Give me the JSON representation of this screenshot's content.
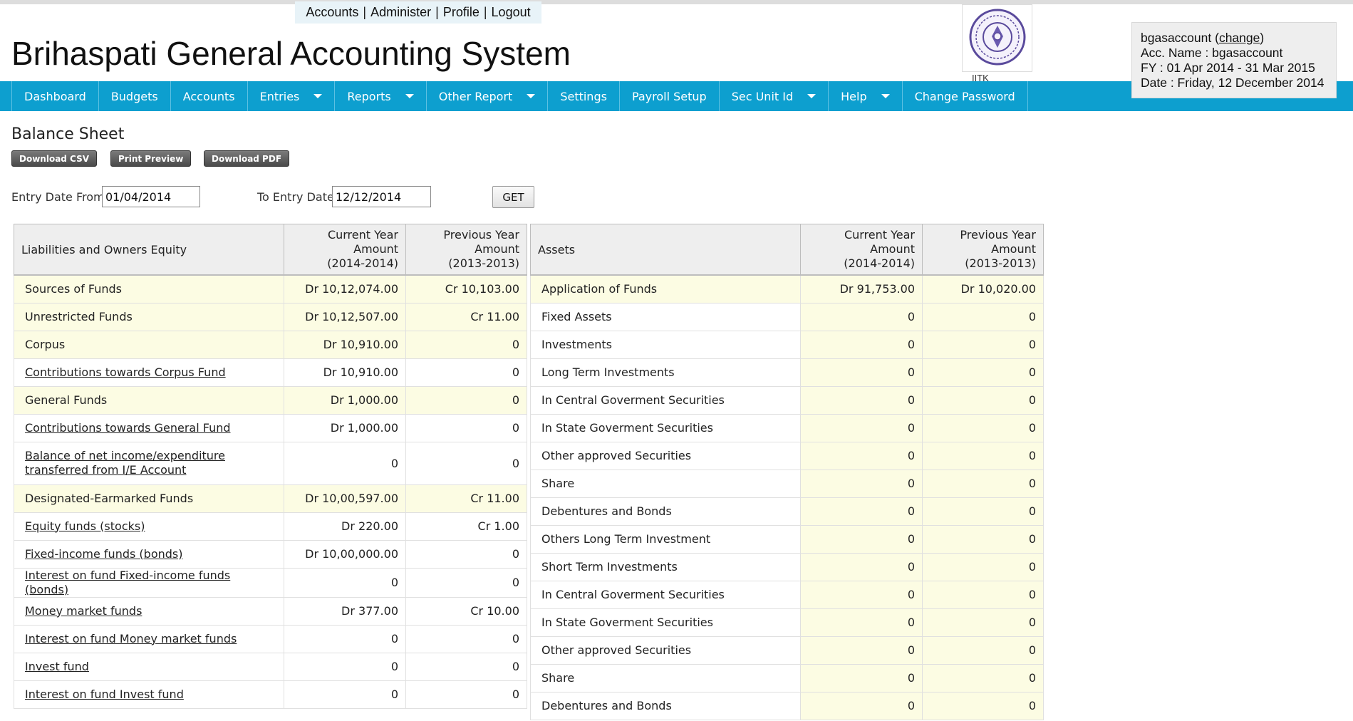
{
  "top_links": [
    "Accounts",
    "Administer",
    "Profile",
    "Logout"
  ],
  "app_title": "Brihaspati General Accounting System",
  "logo_caption": "IITK",
  "nav": [
    {
      "label": "Dashboard",
      "dropdown": false
    },
    {
      "label": "Budgets",
      "dropdown": false
    },
    {
      "label": "Accounts",
      "dropdown": false
    },
    {
      "label": "Entries",
      "dropdown": true
    },
    {
      "label": "Reports",
      "dropdown": true
    },
    {
      "label": "Other Report",
      "dropdown": true
    },
    {
      "label": "Settings",
      "dropdown": false
    },
    {
      "label": "Payroll Setup",
      "dropdown": false
    },
    {
      "label": "Sec Unit Id",
      "dropdown": true
    },
    {
      "label": "Help",
      "dropdown": true
    },
    {
      "label": "Change Password",
      "dropdown": false
    }
  ],
  "user": {
    "account": "bgasaccount",
    "change_label": "change",
    "acc_name": "Acc. Name : bgasaccount",
    "fy": "FY : 01 Apr 2014 - 31 Mar 2015",
    "date": "Date : Friday, 12 December 2014"
  },
  "page_title": "Balance Sheet",
  "buttons": {
    "download_csv": "Download CSV",
    "print_preview": "Print Preview",
    "download_pdf": "Download PDF",
    "get": "GET"
  },
  "filter": {
    "from_label": "Entry Date From",
    "from_value": "01/04/2014",
    "to_label": "To Entry Date",
    "to_value": "12/12/2014"
  },
  "liabilities": {
    "header": {
      "name": "Liabilities and Owners Equity",
      "current": [
        "Current Year",
        "Amount",
        "(2014-2014)"
      ],
      "previous": [
        "Previous Year",
        "Amount",
        "(2013-2013)"
      ]
    },
    "rows": [
      {
        "name": "Sources of Funds",
        "current": "Dr 10,12,074.00",
        "previous": "Cr 10,103.00",
        "link": false,
        "highlight": true
      },
      {
        "name": "Unrestricted Funds",
        "current": "Dr 10,12,507.00",
        "previous": "Cr 11.00",
        "link": false,
        "highlight": true
      },
      {
        "name": "Corpus",
        "current": "Dr 10,910.00",
        "previous": "0",
        "link": false,
        "highlight": true
      },
      {
        "name": "Contributions towards Corpus Fund",
        "current": "Dr 10,910.00",
        "previous": "0",
        "link": true,
        "highlight": false
      },
      {
        "name": "General Funds",
        "current": "Dr 1,000.00",
        "previous": "0",
        "link": false,
        "highlight": true
      },
      {
        "name": "Contributions towards General Fund",
        "current": "Dr 1,000.00",
        "previous": "0",
        "link": true,
        "highlight": false
      },
      {
        "name": "Balance of net income/expenditure transferred from I/E Account",
        "current": "0",
        "previous": "0",
        "link": true,
        "highlight": false
      },
      {
        "name": "Designated-Earmarked Funds",
        "current": "Dr 10,00,597.00",
        "previous": "Cr 11.00",
        "link": false,
        "highlight": true
      },
      {
        "name": "Equity funds (stocks)",
        "current": "Dr 220.00",
        "previous": "Cr 1.00",
        "link": true,
        "highlight": false
      },
      {
        "name": "Fixed-income funds (bonds)",
        "current": "Dr 10,00,000.00",
        "previous": "0",
        "link": true,
        "highlight": false
      },
      {
        "name": "Interest on fund Fixed-income funds (bonds)",
        "current": "0",
        "previous": "0",
        "link": true,
        "highlight": false
      },
      {
        "name": "Money market funds",
        "current": "Dr 377.00",
        "previous": "Cr 10.00",
        "link": true,
        "highlight": false
      },
      {
        "name": "Interest on fund Money market funds",
        "current": "0",
        "previous": "0",
        "link": true,
        "highlight": false
      },
      {
        "name": "Invest fund",
        "current": "0",
        "previous": "0",
        "link": true,
        "highlight": false
      },
      {
        "name": "Interest on fund Invest fund",
        "current": "0",
        "previous": "0",
        "link": true,
        "highlight": false
      }
    ]
  },
  "assets": {
    "header": {
      "name": "Assets",
      "current": [
        "Current Year",
        "Amount",
        "(2014-2014)"
      ],
      "previous": [
        "Previous Year",
        "Amount",
        "(2013-2013)"
      ]
    },
    "rows": [
      {
        "name": "Application of Funds",
        "current": "Dr 91,753.00",
        "previous": "Dr 10,020.00"
      },
      {
        "name": "Fixed Assets",
        "current": "0",
        "previous": "0"
      },
      {
        "name": "Investments",
        "current": "0",
        "previous": "0"
      },
      {
        "name": "Long Term Investments",
        "current": "0",
        "previous": "0"
      },
      {
        "name": "In Central Goverment Securities",
        "current": "0",
        "previous": "0"
      },
      {
        "name": "In State Goverment Securities",
        "current": "0",
        "previous": "0"
      },
      {
        "name": "Other approved Securities",
        "current": "0",
        "previous": "0"
      },
      {
        "name": "Share",
        "current": "0",
        "previous": "0"
      },
      {
        "name": "Debentures and Bonds",
        "current": "0",
        "previous": "0"
      },
      {
        "name": "Others Long Term Investment",
        "current": "0",
        "previous": "0"
      },
      {
        "name": "Short Term Investments",
        "current": "0",
        "previous": "0"
      },
      {
        "name": "In Central Goverment Securities",
        "current": "0",
        "previous": "0"
      },
      {
        "name": "In State Goverment Securities",
        "current": "0",
        "previous": "0"
      },
      {
        "name": "Other approved Securities",
        "current": "0",
        "previous": "0"
      },
      {
        "name": "Share",
        "current": "0",
        "previous": "0"
      },
      {
        "name": "Debentures and Bonds",
        "current": "0",
        "previous": "0"
      }
    ]
  },
  "colors": {
    "nav_bg": "#0d9fcf",
    "row_highlight": "#fcfce3",
    "header_bg": "#eeeeee"
  }
}
